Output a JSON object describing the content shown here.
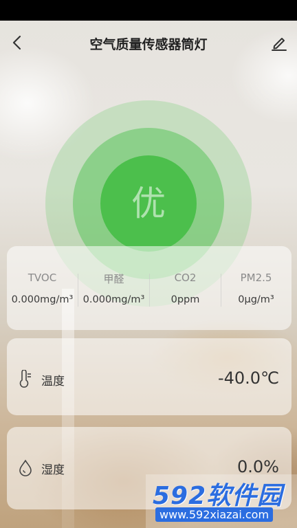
{
  "header": {
    "title": "空气质量传感器筒灯"
  },
  "quality": {
    "label": "优",
    "color": "#4cbf4c"
  },
  "metrics": [
    {
      "name": "TVOC",
      "value": "0.000mg/m³"
    },
    {
      "name": "甲醛",
      "value": "0.000mg/m³"
    },
    {
      "name": "CO2",
      "value": "0ppm"
    },
    {
      "name": "PM2.5",
      "value": "0μg/m³"
    }
  ],
  "temperature": {
    "label": "温度",
    "value": "-40.0℃",
    "icon": "thermometer-icon"
  },
  "humidity": {
    "label": "湿度",
    "value": "0.0%",
    "icon": "droplet-icon"
  },
  "watermark": {
    "logo_text": "592软件园",
    "url": "www.592xiazai.com"
  }
}
